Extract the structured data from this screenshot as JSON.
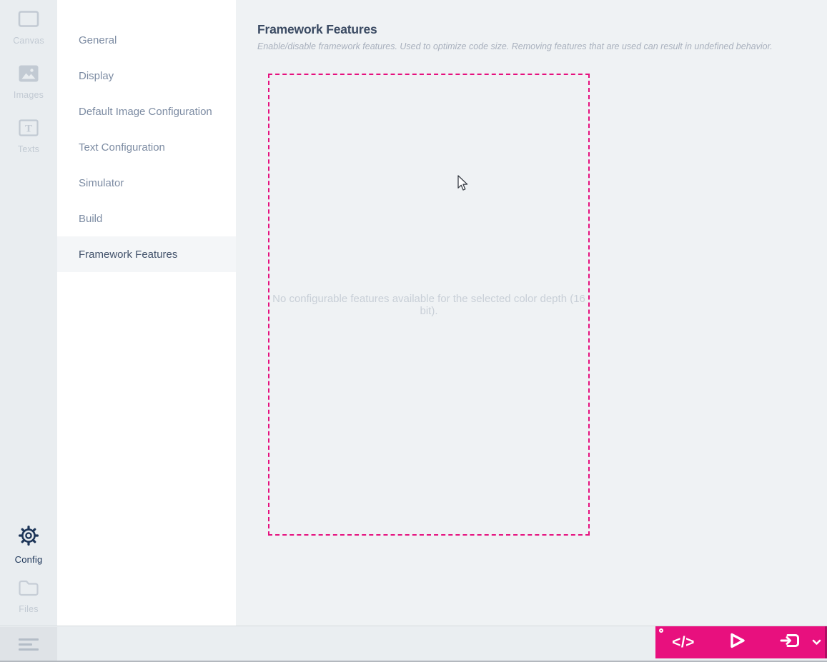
{
  "icon_rail": {
    "items": [
      {
        "label": "Canvas",
        "icon": "canvas-icon",
        "active": false
      },
      {
        "label": "Images",
        "icon": "images-icon",
        "active": false
      },
      {
        "label": "Texts",
        "icon": "texts-icon",
        "active": false
      }
    ],
    "bottom_items": [
      {
        "label": "Config",
        "icon": "gear-icon",
        "active": true
      },
      {
        "label": "Files",
        "icon": "folder-icon",
        "active": false
      }
    ]
  },
  "sidebar": {
    "items": [
      {
        "label": "General"
      },
      {
        "label": "Display"
      },
      {
        "label": "Default Image Configuration"
      },
      {
        "label": "Text Configuration"
      },
      {
        "label": "Simulator"
      },
      {
        "label": "Build"
      },
      {
        "label": "Framework Features",
        "selected": true
      }
    ]
  },
  "main": {
    "title": "Framework Features",
    "subtitle": "Enable/disable framework features. Used to optimize code size. Removing features that are used can result in undefined behavior.",
    "empty_message": "No configurable features available for the selected color depth (16 bit)."
  },
  "toolbar": {
    "code_label": "</>",
    "icons": [
      "code-icon",
      "play-icon",
      "deploy-icon",
      "chevron-down-icon"
    ]
  },
  "colors": {
    "accent_pink": "#e8107e",
    "accent_pink_dark": "#b00d63",
    "active_navy": "#1d3558",
    "rail_bg": "#e9edf0",
    "main_bg": "#eff2f4",
    "muted_icon": "#c2cad3",
    "menu_text": "#7d8ca3",
    "selected_text": "#42526b",
    "title_text": "#3b4b63"
  }
}
